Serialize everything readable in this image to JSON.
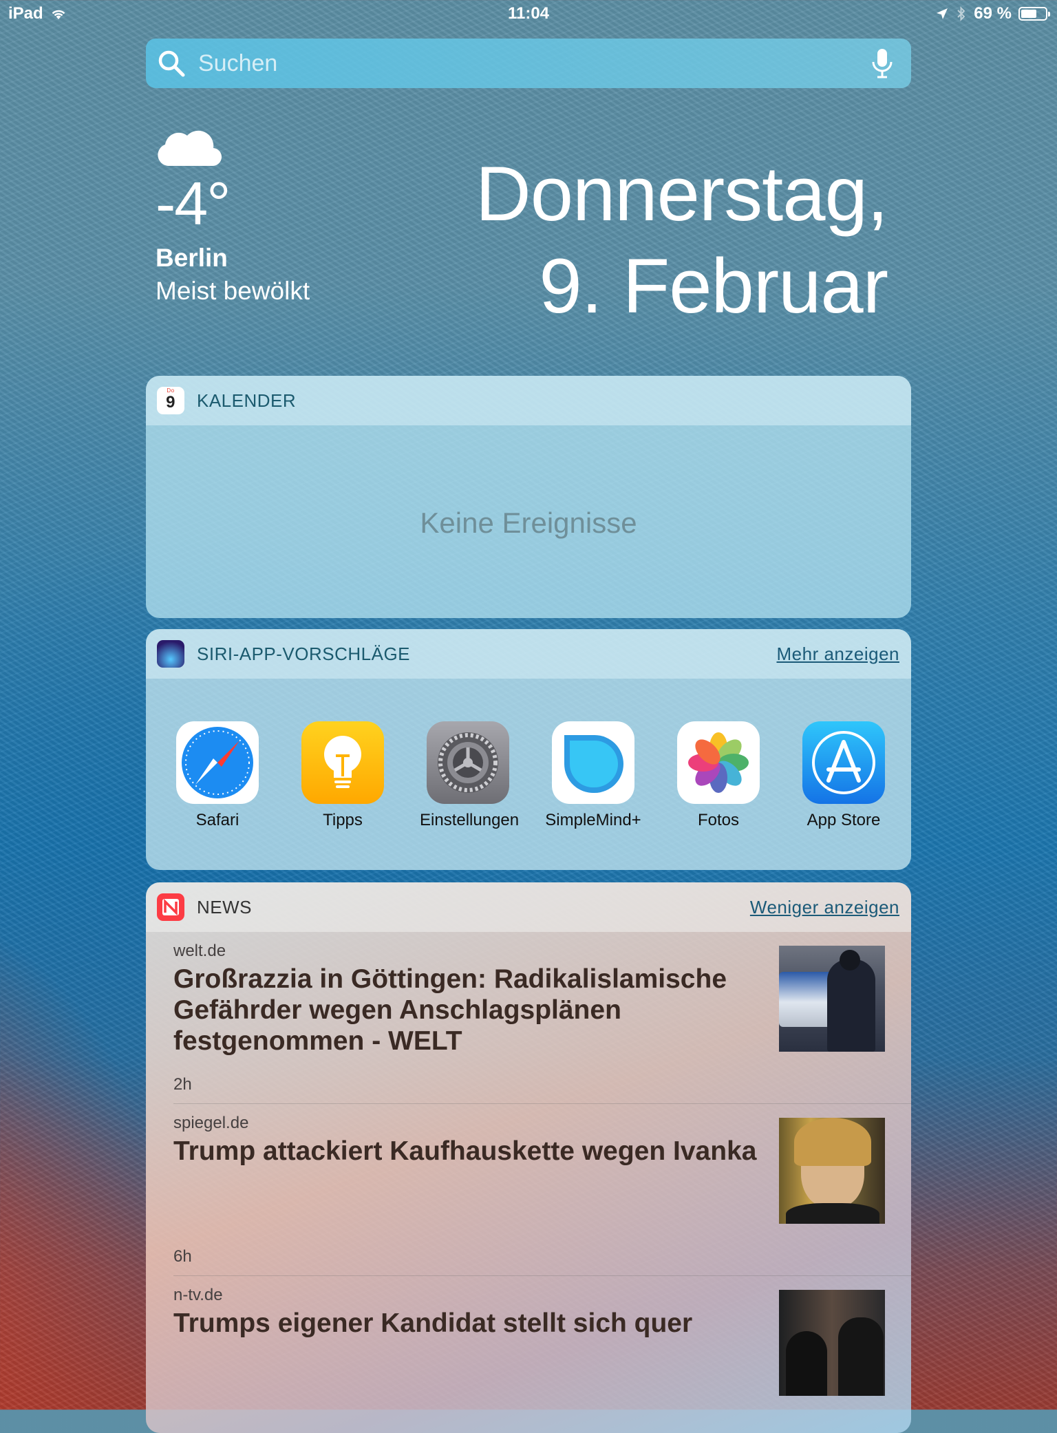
{
  "status_bar": {
    "device": "iPad",
    "time": "11:04",
    "battery_percent": "69 %",
    "battery_level": 0.69
  },
  "search": {
    "placeholder": "Suchen"
  },
  "weather": {
    "temperature": "-4°",
    "city": "Berlin",
    "condition": "Meist bewölkt",
    "icon": "cloud-icon"
  },
  "date": {
    "weekday": "Donnerstag,",
    "day_month": "9. Februar"
  },
  "calendar_widget": {
    "title": "KALENDER",
    "icon_day": "Do",
    "icon_date": "9",
    "empty_text": "Keine Ereignisse"
  },
  "siri_widget": {
    "title": "SIRI-APP-VORSCHLÄGE",
    "more_label": "Mehr anzeigen",
    "apps": [
      {
        "label": "Safari"
      },
      {
        "label": "Tipps"
      },
      {
        "label": "Einstellungen"
      },
      {
        "label": "SimpleMind+"
      },
      {
        "label": "Fotos"
      },
      {
        "label": "App Store"
      }
    ]
  },
  "news_widget": {
    "title": "NEWS",
    "less_label": "Weniger anzeigen",
    "items": [
      {
        "source": "welt.de",
        "headline": "Großrazzia in Göttingen: Radikalislamische Gefährder wegen Anschlagsplänen festgenommen - WELT",
        "age": "2h"
      },
      {
        "source": "spiegel.de",
        "headline": "Trump attackiert Kaufhauskette wegen Ivanka",
        "age": "6h"
      },
      {
        "source": "n-tv.de",
        "headline": "Trumps eigener Kandidat stellt sich quer",
        "age": ""
      }
    ]
  },
  "colors": {
    "accent_link": "#1b5a78",
    "widget_title": "#1b5a6e",
    "headline": "#3a2a24"
  }
}
